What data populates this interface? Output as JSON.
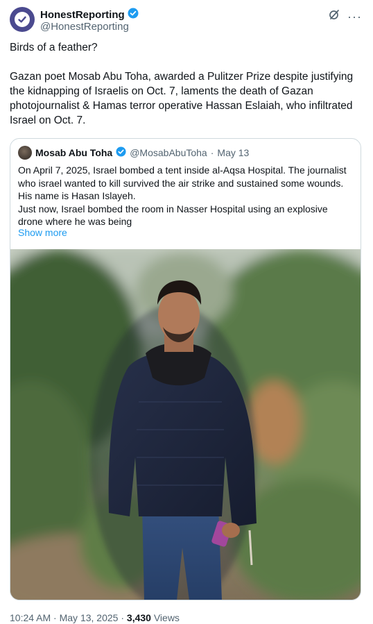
{
  "author": {
    "display_name": "HonestReporting",
    "handle": "@HonestReporting",
    "verified": true,
    "avatar_icon": "checkmark-logo-icon"
  },
  "header_icons": [
    "grok-icon",
    "more-dots-icon"
  ],
  "tweet": {
    "text": "Birds of a feather?\n\nGazan poet Mosab Abu Toha, awarded a Pulitzer Prize despite justifying the kidnapping of Israelis on Oct. 7, laments the death of Gazan photojournalist & Hamas terror operative Hassan Eslaiah, who infiltrated Israel on Oct. 7."
  },
  "quoted": {
    "display_name": "Mosab Abu Toha",
    "handle": "@MosabAbuToha",
    "separator": "·",
    "date": "May 13",
    "text": "On April 7, 2025, Israel bombed a tent inside al-Aqsa Hospital. The journalist who israel wanted to kill survived the air strike and sustained some wounds. His name is Hasan Islayeh.\nJust now, Israel bombed the room in Nasser Hospital using an explosive drone where he was being",
    "show_more": "Show more"
  },
  "footer": {
    "time": "10:24 AM",
    "sep1": " · ",
    "date": "May 13, 2025",
    "sep2": " · ",
    "views_count": "3,430",
    "views_label": " Views"
  },
  "colors": {
    "verified_blue": "#1d9bf0",
    "link_blue": "#1d9bf0",
    "avatar_purple": "#4b4a8f"
  }
}
